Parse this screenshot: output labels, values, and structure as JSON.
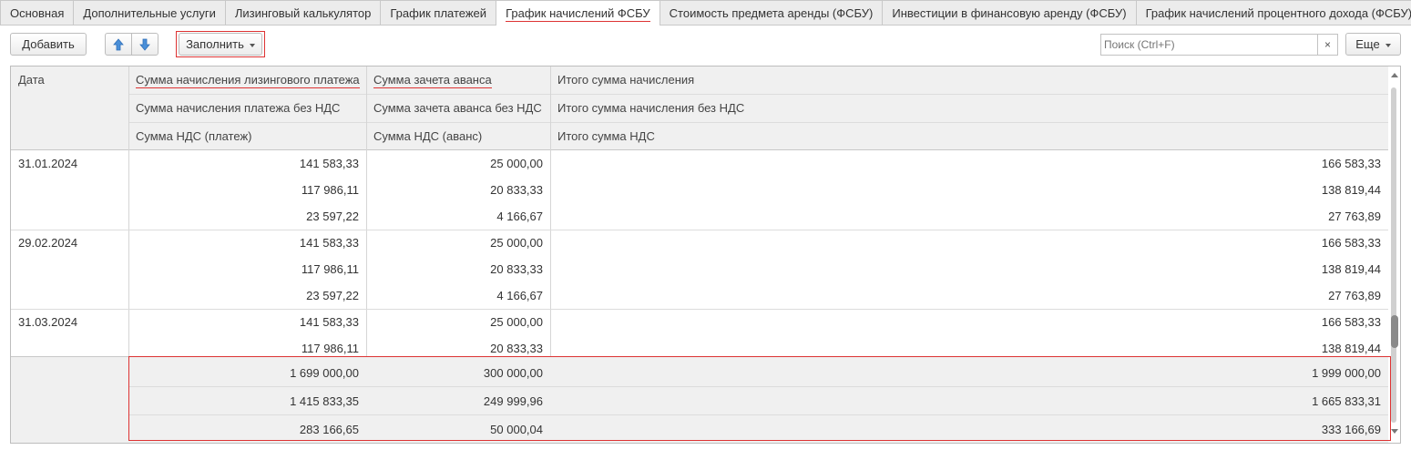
{
  "tabs": [
    {
      "label": "Основная"
    },
    {
      "label": "Дополнительные услуги"
    },
    {
      "label": "Лизинговый калькулятор"
    },
    {
      "label": "График платежей"
    },
    {
      "label": "График начислений ФСБУ"
    },
    {
      "label": "Стоимость предмета аренды (ФСБУ)"
    },
    {
      "label": "Инвестиции в финансовую аренду (ФСБУ)"
    },
    {
      "label": "График начислений процентного дохода (ФСБУ)"
    }
  ],
  "active_tab_index": 4,
  "toolbar": {
    "add_label": "Добавить",
    "move_up_icon": "arrow-up-icon",
    "move_down_icon": "arrow-down-icon",
    "fill_label": "Заполнить",
    "search_placeholder": "Поиск (Ctrl+F)",
    "clear_glyph": "×",
    "more_label": "Еще"
  },
  "table": {
    "headers": {
      "date": "Дата",
      "col1": [
        "Сумма начисления лизингового платежа",
        "Сумма начисления платежа без НДС",
        "Сумма НДС (платеж)"
      ],
      "col2": [
        "Сумма зачета аванса",
        "Сумма зачета аванса без НДС",
        "Сумма НДС (аванс)"
      ],
      "col3": [
        "Итого сумма начисления",
        "Итого сумма начисления без НДС",
        "Итого сумма НДС"
      ]
    },
    "rows": [
      {
        "date": "31.01.2024",
        "col1": [
          "141 583,33",
          "117 986,11",
          "23 597,22"
        ],
        "col2": [
          "25 000,00",
          "20 833,33",
          "4 166,67"
        ],
        "col3": [
          "166 583,33",
          "138 819,44",
          "27 763,89"
        ]
      },
      {
        "date": "29.02.2024",
        "col1": [
          "141 583,33",
          "117 986,11",
          "23 597,22"
        ],
        "col2": [
          "25 000,00",
          "20 833,33",
          "4 166,67"
        ],
        "col3": [
          "166 583,33",
          "138 819,44",
          "27 763,89"
        ]
      },
      {
        "date": "31.03.2024",
        "col1": [
          "141 583,33",
          "117 986,11"
        ],
        "col2": [
          "25 000,00",
          "20 833,33"
        ],
        "col3": [
          "166 583,33",
          "138 819,44"
        ]
      }
    ],
    "totals": {
      "col1": [
        "1 699 000,00",
        "1 415 833,35",
        "283 166,65"
      ],
      "col2": [
        "300 000,00",
        "249 999,96",
        "50 000,04"
      ],
      "col3": [
        "1 999 000,00",
        "1 665 833,31",
        "333 166,69"
      ]
    }
  },
  "colors": {
    "accent_underline": "#dd3333",
    "header_bg": "#f0f0f0"
  }
}
